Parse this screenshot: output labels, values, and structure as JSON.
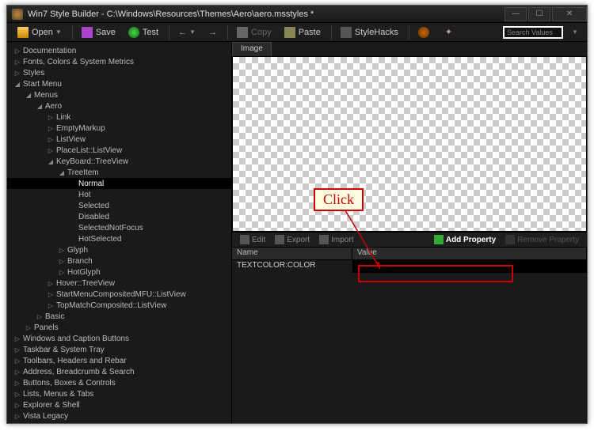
{
  "title": "Win7 Style Builder - C:\\Windows\\Resources\\Themes\\Aero\\aero.msstyles *",
  "toolbar": {
    "open": "Open",
    "save": "Save",
    "test": "Test",
    "copy": "Copy",
    "paste": "Paste",
    "stylehacks": "StyleHacks",
    "search_placeholder": "Search Values"
  },
  "tree": [
    {
      "d": 0,
      "e": "r",
      "t": "Documentation"
    },
    {
      "d": 0,
      "e": "r",
      "t": "Fonts, Colors & System Metrics"
    },
    {
      "d": 0,
      "e": "r",
      "t": "Styles"
    },
    {
      "d": 0,
      "e": "d",
      "t": "Start Menu"
    },
    {
      "d": 1,
      "e": "d",
      "t": "Menus"
    },
    {
      "d": 2,
      "e": "d",
      "t": "Aero"
    },
    {
      "d": 3,
      "e": "r",
      "t": "Link"
    },
    {
      "d": 3,
      "e": "r",
      "t": "EmptyMarkup"
    },
    {
      "d": 3,
      "e": "r",
      "t": "ListView"
    },
    {
      "d": 3,
      "e": "r",
      "t": "PlaceList::ListView"
    },
    {
      "d": 3,
      "e": "d",
      "t": "KeyBoard::TreeView"
    },
    {
      "d": 4,
      "e": "d",
      "t": "TreeItem"
    },
    {
      "d": 5,
      "e": "",
      "t": "Normal",
      "sel": true
    },
    {
      "d": 5,
      "e": "",
      "t": "Hot"
    },
    {
      "d": 5,
      "e": "",
      "t": "Selected"
    },
    {
      "d": 5,
      "e": "",
      "t": "Disabled"
    },
    {
      "d": 5,
      "e": "",
      "t": "SelectedNotFocus"
    },
    {
      "d": 5,
      "e": "",
      "t": "HotSelected"
    },
    {
      "d": 4,
      "e": "r",
      "t": "Glyph"
    },
    {
      "d": 4,
      "e": "r",
      "t": "Branch"
    },
    {
      "d": 4,
      "e": "r",
      "t": "HotGlyph"
    },
    {
      "d": 3,
      "e": "r",
      "t": "Hover::TreeView"
    },
    {
      "d": 3,
      "e": "r",
      "t": "StartMenuCompositedMFU::ListView"
    },
    {
      "d": 3,
      "e": "r",
      "t": "TopMatchComposited::ListView"
    },
    {
      "d": 2,
      "e": "r",
      "t": "Basic"
    },
    {
      "d": 1,
      "e": "r",
      "t": "Panels"
    },
    {
      "d": 0,
      "e": "r",
      "t": "Windows and Caption Buttons"
    },
    {
      "d": 0,
      "e": "r",
      "t": "Taskbar & System Tray"
    },
    {
      "d": 0,
      "e": "r",
      "t": "Toolbars, Headers and Rebar"
    },
    {
      "d": 0,
      "e": "r",
      "t": "Address, Breadcrumb & Search"
    },
    {
      "d": 0,
      "e": "r",
      "t": "Buttons, Boxes & Controls"
    },
    {
      "d": 0,
      "e": "r",
      "t": "Lists, Menus & Tabs"
    },
    {
      "d": 0,
      "e": "r",
      "t": "Explorer & Shell"
    },
    {
      "d": 0,
      "e": "r",
      "t": "Vista Legacy"
    }
  ],
  "image_tab": "Image",
  "propbar": {
    "edit": "Edit",
    "export": "Export",
    "import": "Import",
    "add": "Add Property",
    "remove": "Remove Property"
  },
  "grid": {
    "col_name": "Name",
    "col_value": "Value",
    "rows": [
      {
        "name": "TEXTCOLOR:COLOR",
        "value": ""
      }
    ]
  },
  "annotation": {
    "label": "Click"
  }
}
